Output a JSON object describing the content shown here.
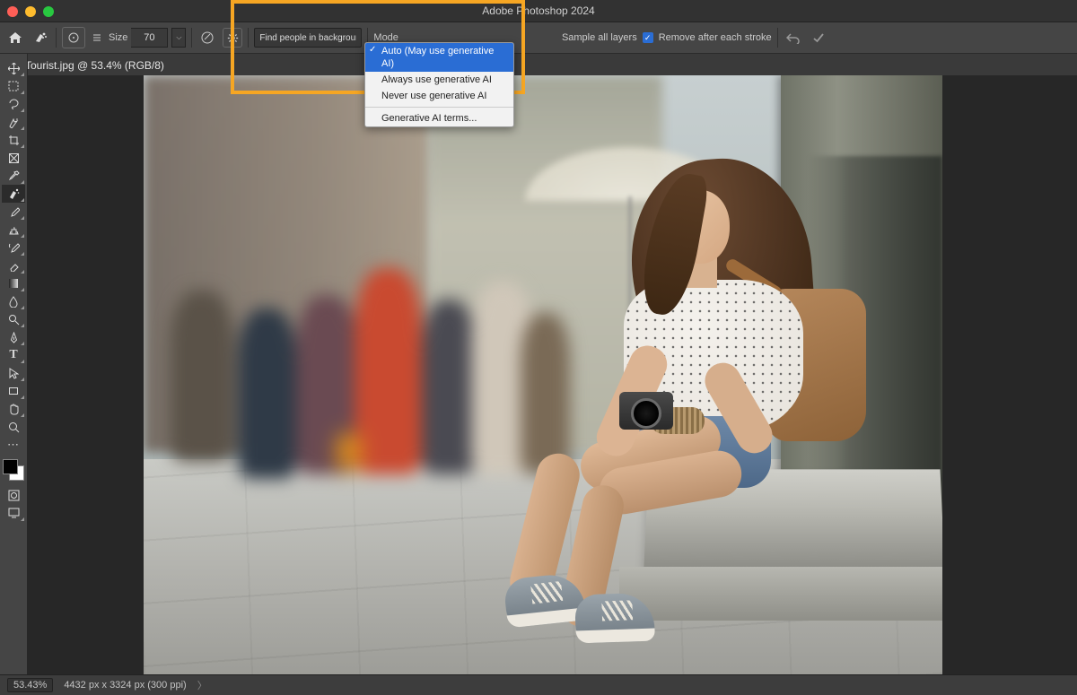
{
  "app_title": "Adobe Photoshop 2024",
  "document_tab": "Tourist.jpg @ 53.4% (RGB/8)",
  "options_bar": {
    "size_label": "Size",
    "size_value": "70",
    "prompt_value": "Find people in background",
    "mode_label": "Mode",
    "sample_all_layers": "Sample all layers",
    "remove_after": "Remove after each stroke"
  },
  "mode_dropdown": {
    "items": [
      "Auto (May use generative AI)",
      "Always use generative AI",
      "Never use generative AI"
    ],
    "terms": "Generative AI terms...",
    "selected_index": 0
  },
  "status": {
    "zoom": "53.43%",
    "dimensions": "4432 px x 3324 px (300 ppi)"
  },
  "tools": [
    "move",
    "marquee",
    "lasso",
    "quick-select",
    "crop",
    "frame",
    "eyedropper",
    "spot-heal",
    "brush",
    "clone",
    "history-brush",
    "eraser",
    "gradient",
    "blur",
    "dodge",
    "pen",
    "type",
    "path-select",
    "rectangle",
    "hand",
    "zoom",
    "more",
    "edit-toolbar"
  ]
}
